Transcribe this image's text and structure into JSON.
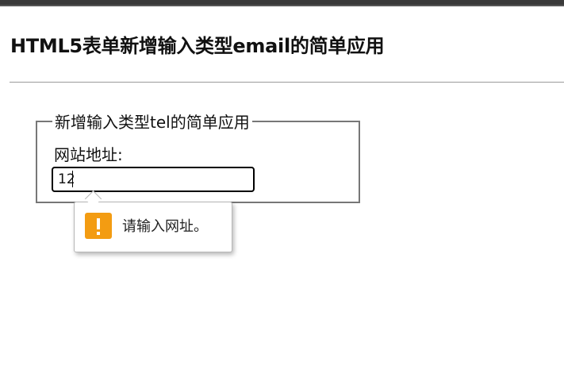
{
  "page": {
    "title": "HTML5表单新增输入类型email的简单应用"
  },
  "form": {
    "legend": "新增输入类型tel的简单应用",
    "field_label": "网站地址:",
    "input_value": "12"
  },
  "tooltip": {
    "icon": "warning-icon",
    "message": "请输入网址。"
  },
  "colors": {
    "warning_icon_bg": "#f39c12",
    "fieldset_border": "#777777",
    "focused_input_border": "#000000"
  }
}
